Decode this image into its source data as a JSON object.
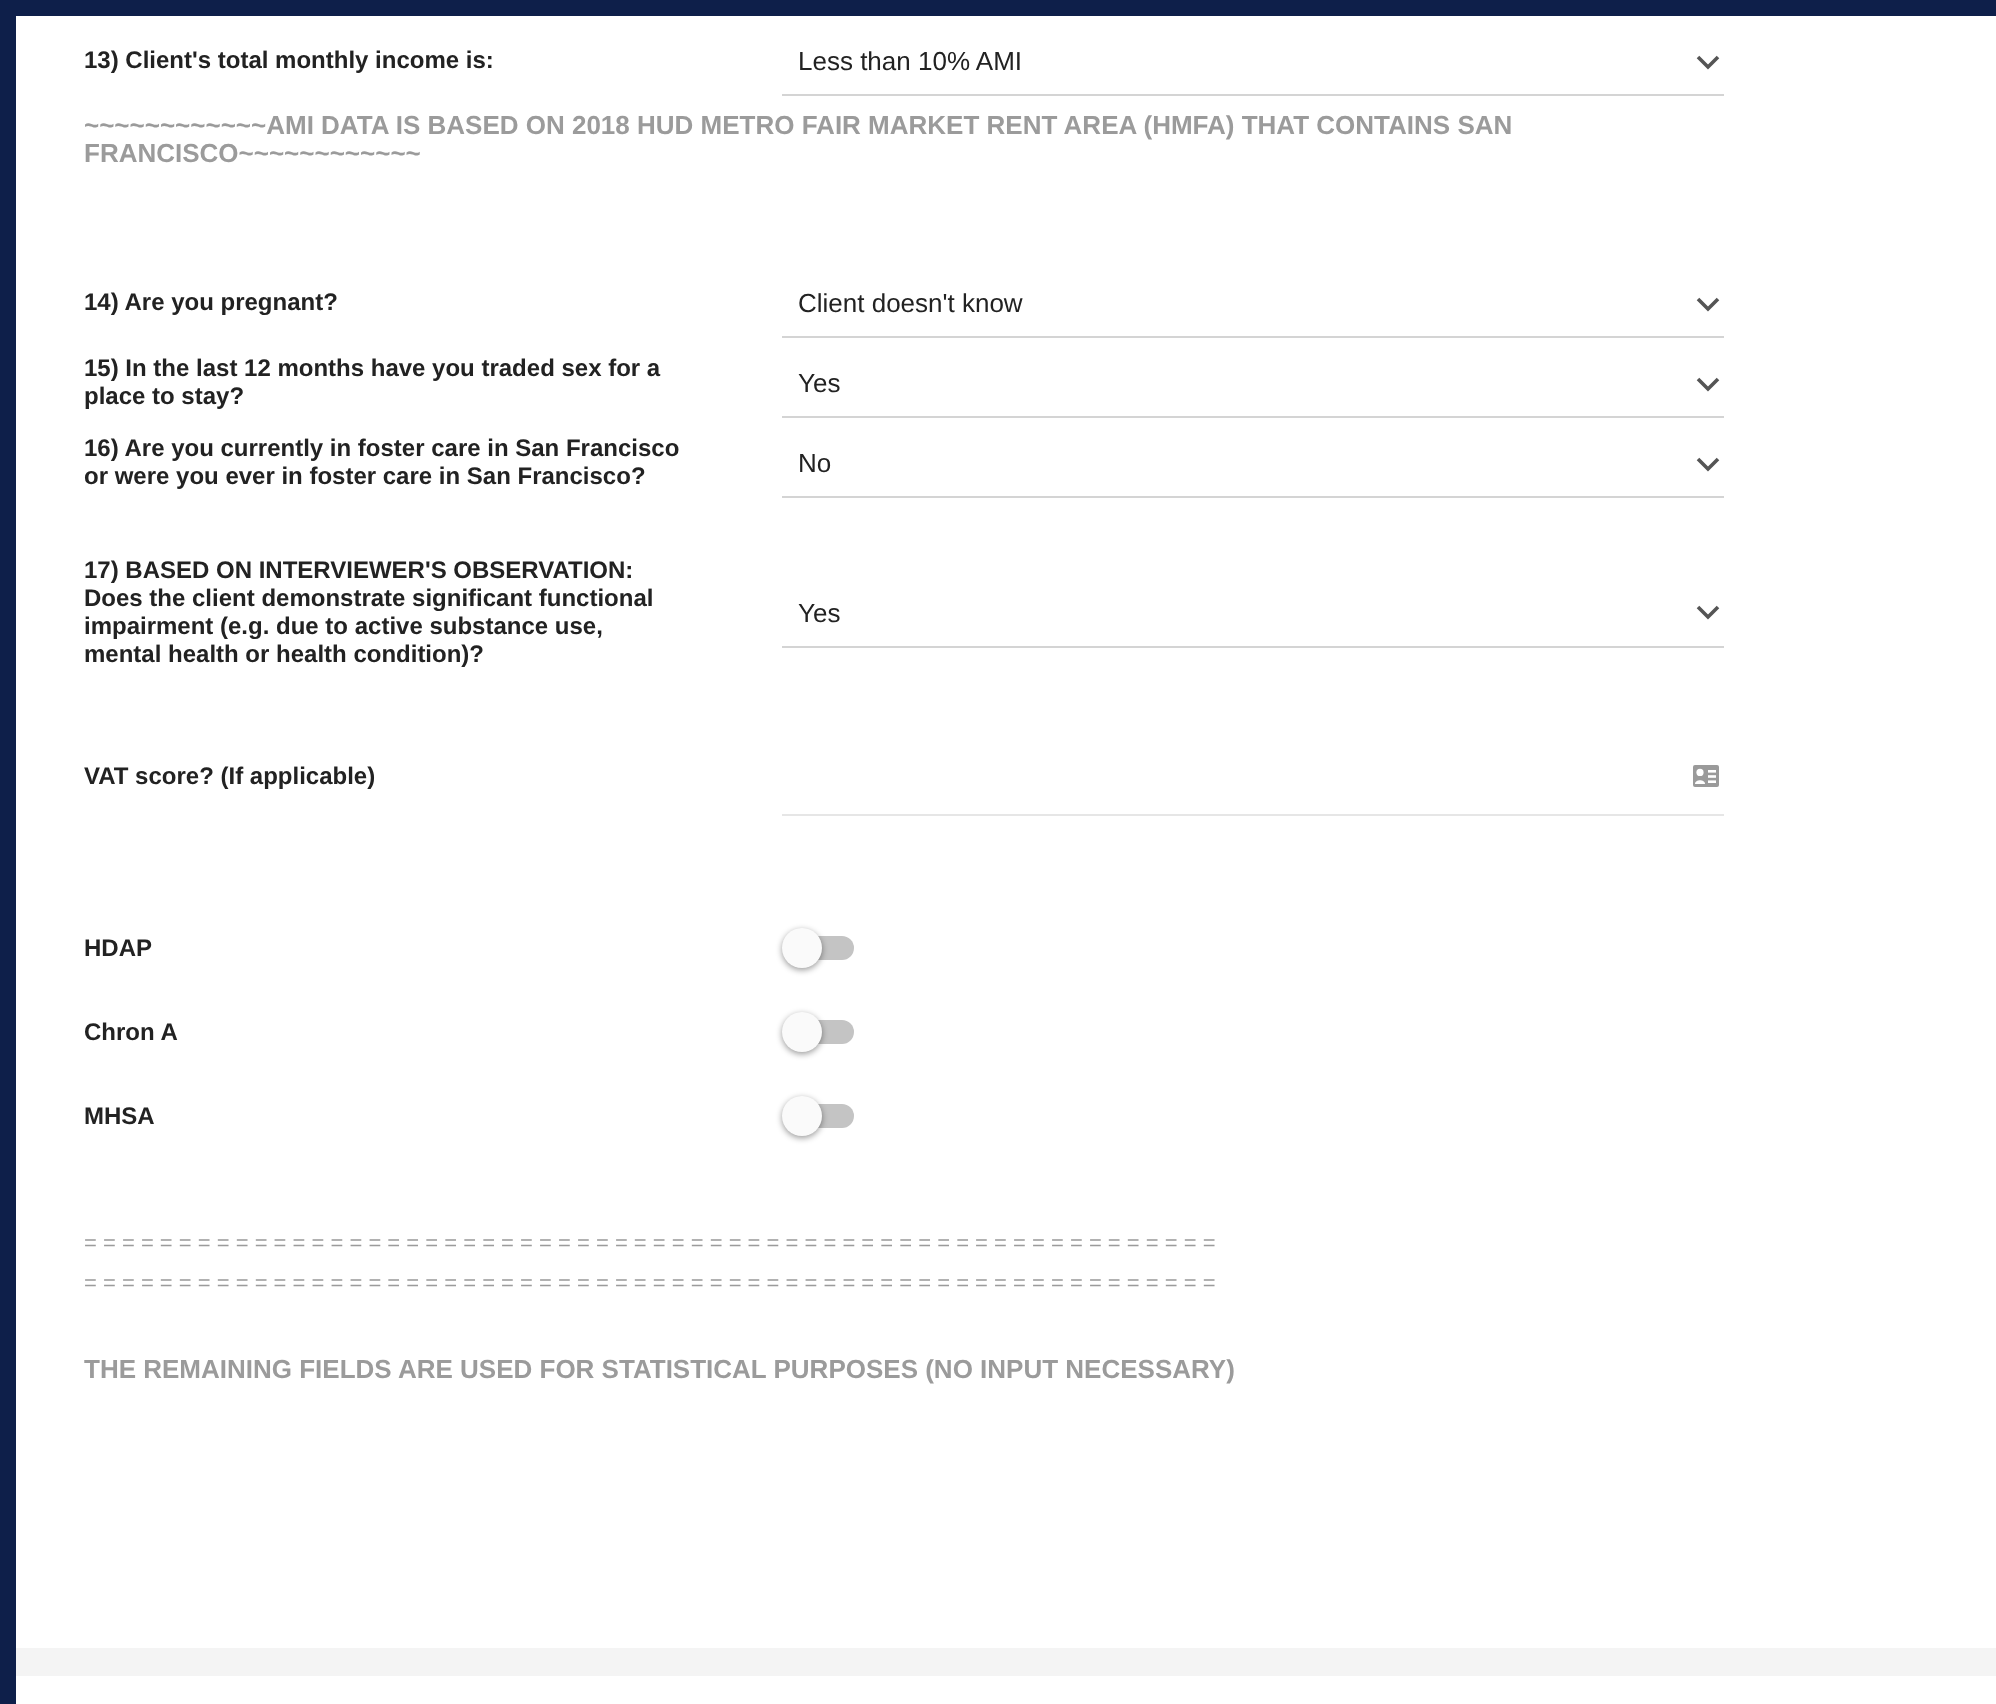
{
  "items": [
    {
      "kind": "select",
      "label": "13) Client's total monthly income is:",
      "value": "Less than 10% AMI"
    },
    {
      "kind": "note",
      "text": "~~~~~~~~~~~~AMI DATA IS BASED ON 2018 HUD METRO FAIR MARKET RENT AREA (HMFA) THAT CONTAINS SAN FRANCISCO~~~~~~~~~~~~"
    },
    {
      "kind": "select",
      "label": "14) Are you pregnant?",
      "value": "Client doesn't know"
    },
    {
      "kind": "select",
      "label": "15) In the last 12 months have you traded sex for a place to stay?",
      "value": "Yes"
    },
    {
      "kind": "select",
      "label": "16) Are you currently in foster care in San Francisco or were you ever in foster care in San Francisco?",
      "value": "No"
    },
    {
      "kind": "select",
      "label": "17) BASED ON INTERVIEWER'S OBSERVATION: Does the client demonstrate significant functional impairment (e.g. due to active substance use, mental health or health condition)?",
      "value": "Yes"
    },
    {
      "kind": "text",
      "label": "VAT score? (If applicable)"
    },
    {
      "kind": "toggle",
      "label": "HDAP",
      "on": false
    },
    {
      "kind": "toggle",
      "label": "Chron A",
      "on": false
    },
    {
      "kind": "toggle",
      "label": "MHSA",
      "on": false
    },
    {
      "kind": "rule",
      "text": "= = = = = = = = = = = = = = = = = = = = = = = = = = = = = = = = = = = = = = = = = = = = = = = = = = = = = = = = = = = ="
    },
    {
      "kind": "rule",
      "text": "= = = = = = = = = = = = = = = = = = = = = = = = = = = = = = = = = = = = = = = = = = = = = = = = = = = = = = = = = = = ="
    },
    {
      "kind": "note",
      "text": "THE REMAINING FIELDS ARE USED FOR STATISTICAL PURPOSES (NO INPUT NECESSARY)"
    }
  ]
}
